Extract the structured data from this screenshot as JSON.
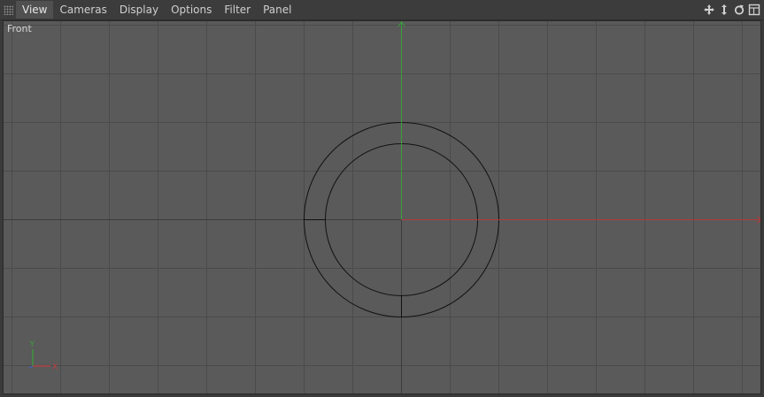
{
  "menubar": {
    "items": [
      {
        "label": "View",
        "active": true
      },
      {
        "label": "Cameras",
        "active": false
      },
      {
        "label": "Display",
        "active": false
      },
      {
        "label": "Options",
        "active": false
      },
      {
        "label": "Filter",
        "active": false
      },
      {
        "label": "Panel",
        "active": false
      }
    ],
    "nav_icons": [
      "move-icon",
      "zoom-icon",
      "rotate-icon",
      "maximize-icon"
    ]
  },
  "viewport": {
    "label": "Front",
    "background": "#5a5a5a",
    "grid_color": "#4a4a4a",
    "x_axis_color": "#b33a3a",
    "y_axis_color": "#3aa03a",
    "object_color": "#111111",
    "axis_gizmo": {
      "y_label": "Y",
      "x_label": "X"
    }
  }
}
